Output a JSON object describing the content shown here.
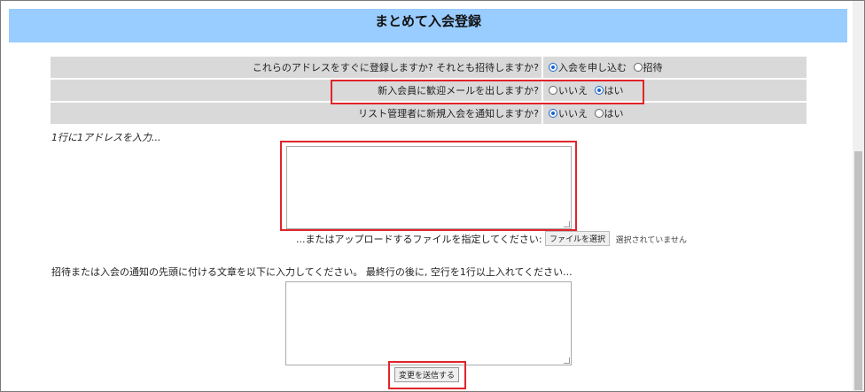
{
  "header": {
    "title": "まとめて入会登録"
  },
  "options": [
    {
      "question": "これらのアドレスをすぐに登録しますか? それとも招待しますか?",
      "choices": [
        {
          "label": "入会を申し込む",
          "checked": true
        },
        {
          "label": "招待",
          "checked": false
        }
      ]
    },
    {
      "question": "新入会員に歓迎メールを出しますか?",
      "choices": [
        {
          "label": "いいえ",
          "checked": false
        },
        {
          "label": "はい",
          "checked": true
        }
      ]
    },
    {
      "question": "リスト管理者に新規入会を通知しますか?",
      "choices": [
        {
          "label": "いいえ",
          "checked": true
        },
        {
          "label": "はい",
          "checked": false
        }
      ]
    }
  ],
  "addresses": {
    "label": "1行に1アドレスを入力...",
    "value": ""
  },
  "upload": {
    "label": "...またはアップロードするファイルを指定してください:",
    "button": "ファイルを選択",
    "status": "選択されていません"
  },
  "intro_text": {
    "label": "招待または入会の通知の先頭に付ける文章を以下に入力してください。 最終行の後に, 空行を1行以上入れてください...",
    "value": ""
  },
  "submit": {
    "label": "変更を送信する"
  },
  "colors": {
    "header_bg": "#99ccff",
    "row_bg": "#d9d9d9",
    "highlight": "#e0242b"
  }
}
